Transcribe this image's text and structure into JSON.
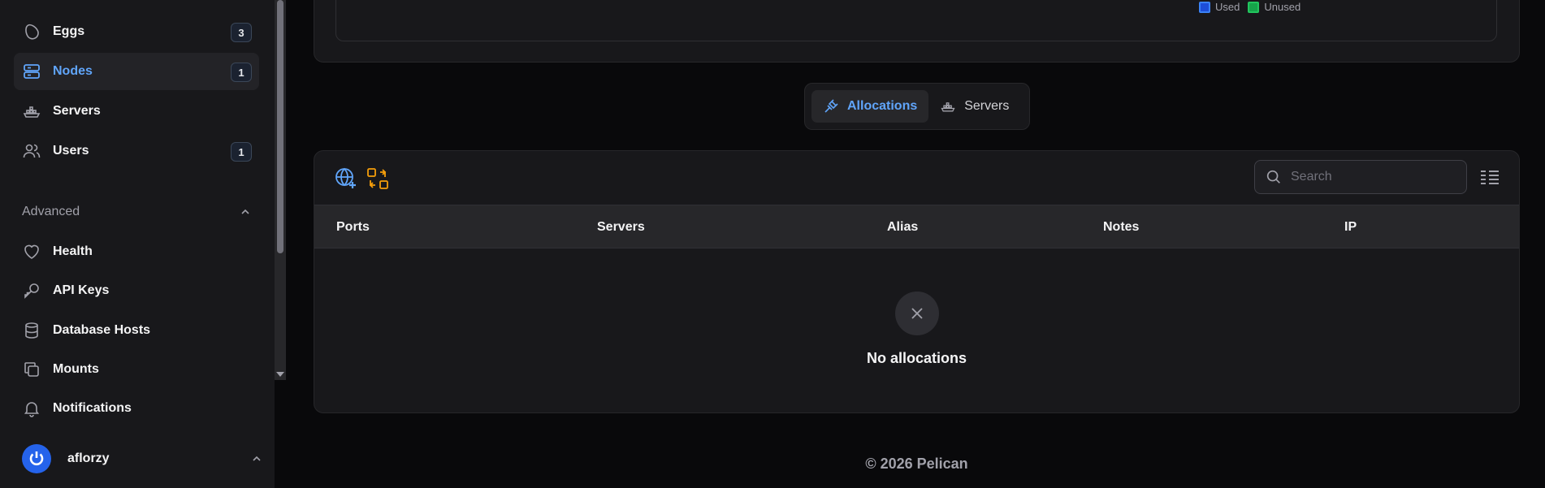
{
  "sidebar": {
    "items": [
      {
        "label": "Eggs",
        "badge": "3",
        "icon": "egg-icon"
      },
      {
        "label": "Nodes",
        "badge": "1",
        "icon": "server-stack-icon",
        "active": true
      },
      {
        "label": "Servers",
        "badge": "",
        "icon": "ship-icon"
      },
      {
        "label": "Users",
        "badge": "1",
        "icon": "users-icon"
      }
    ],
    "advanced": {
      "label": "Advanced",
      "items": [
        {
          "label": "Health",
          "icon": "heart-icon"
        },
        {
          "label": "API Keys",
          "icon": "key-icon"
        },
        {
          "label": "Database Hosts",
          "icon": "database-icon"
        },
        {
          "label": "Mounts",
          "icon": "copy-icon"
        },
        {
          "label": "Notifications",
          "icon": "bell-icon"
        }
      ]
    },
    "user": {
      "name": "aflorzy"
    }
  },
  "chart_legend": {
    "used": {
      "label": "Used",
      "color": "#3b82f6"
    },
    "unused": {
      "label": "Unused",
      "color": "#22c55e"
    }
  },
  "tabs": [
    {
      "label": "Allocations",
      "active": true,
      "icon": "plug-icon"
    },
    {
      "label": "Servers",
      "active": false,
      "icon": "ship-icon"
    }
  ],
  "table": {
    "search_placeholder": "Search",
    "columns": [
      "Ports",
      "Servers",
      "Alias",
      "Notes",
      "IP"
    ],
    "empty_text": "No allocations"
  },
  "footer": {
    "text": "© 2026 Pelican"
  },
  "colors": {
    "accent": "#60a5fa",
    "warning": "#f59e0b",
    "background": "#09090b",
    "panel": "#18181b"
  }
}
